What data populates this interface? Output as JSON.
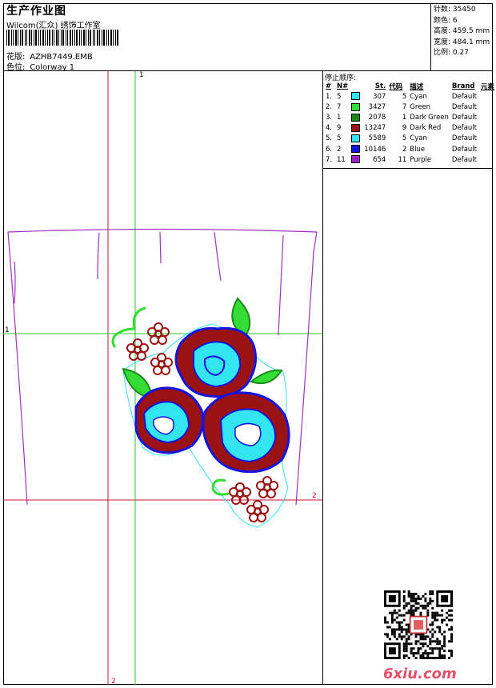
{
  "header": {
    "title": "生产作业图",
    "company": "Wilcom(汇众) 绣饰工作室",
    "design_label": "花版:",
    "design_value": "AZHB7449.EMB",
    "colorway_label": "色位:",
    "colorway_value": "Colorway 1"
  },
  "stats": [
    {
      "label": "针数:",
      "value": "35450"
    },
    {
      "label": "颜色:",
      "value": "6"
    },
    {
      "label": "高度:",
      "value": "459.5 mm"
    },
    {
      "label": "宽度:",
      "value": "484.1 mm"
    },
    {
      "label": "比例:",
      "value": "0.27"
    }
  ],
  "stop_sequence": {
    "title": "停止顺序:",
    "columns": [
      "#",
      "N#",
      "",
      "St.",
      "代码",
      "描述",
      "Brand",
      "元素"
    ],
    "rows": [
      {
        "idx": "1.",
        "n": "5",
        "color": "#33e5f0",
        "stitches": "307",
        "code": "5",
        "desc": "Cyan",
        "brand": "Default"
      },
      {
        "idx": "2.",
        "n": "7",
        "color": "#33dd33",
        "stitches": "3427",
        "code": "7",
        "desc": "Green",
        "brand": "Default"
      },
      {
        "idx": "3.",
        "n": "1",
        "color": "#1e8a1e",
        "stitches": "2078",
        "code": "1",
        "desc": "Dark Green",
        "brand": "Default"
      },
      {
        "idx": "4.",
        "n": "9",
        "color": "#9a1212",
        "stitches": "13247",
        "code": "9",
        "desc": "Dark Red",
        "brand": "Default"
      },
      {
        "idx": "5.",
        "n": "5",
        "color": "#33e5f0",
        "stitches": "5589",
        "code": "5",
        "desc": "Cyan",
        "brand": "Default"
      },
      {
        "idx": "6.",
        "n": "2",
        "color": "#1414e0",
        "stitches": "10146",
        "code": "2",
        "desc": "Blue",
        "brand": "Default"
      },
      {
        "idx": "7.",
        "n": "11",
        "color": "#a020c8",
        "stitches": "654",
        "code": "11",
        "desc": "Purple",
        "brand": "Default"
      }
    ]
  },
  "canvas": {
    "axis_label_top": "1",
    "axis_label_right": "2",
    "axis_label_bottom": "2",
    "axis_label_left": "1"
  },
  "watermark": "6xiu.com"
}
